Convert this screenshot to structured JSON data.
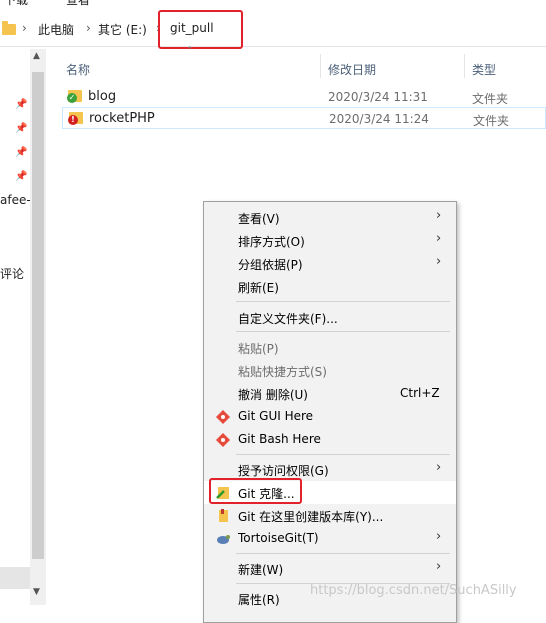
{
  "top_strip": {
    "text_a": "下载",
    "text_b": "查看"
  },
  "breadcrumb": {
    "items": [
      "此电脑",
      "其它 (E:)",
      "git_pull"
    ],
    "separator": "›"
  },
  "nav": {
    "fragment_1": "afee-a",
    "fragment_2": "评论"
  },
  "columns": {
    "name": "名称",
    "date": "修改日期",
    "type": "类型"
  },
  "files": [
    {
      "name": "blog",
      "date": "2020/3/24 11:31",
      "type": "文件夹",
      "overlay": "check-overlay",
      "overlay_color": "#3aa23a"
    },
    {
      "name": "rocketPHP",
      "date": "2020/3/24 11:24",
      "type": "文件夹",
      "overlay": "error-overlay",
      "overlay_color": "#d42020"
    }
  ],
  "context_menu": {
    "view": "查看(V)",
    "sort": "排序方式(O)",
    "group": "分组依据(P)",
    "refresh": "刷新(E)",
    "customize": "自定义文件夹(F)...",
    "paste": "粘贴(P)",
    "paste_shortcut": "粘贴快捷方式(S)",
    "undo": "撤消 删除(U)",
    "undo_shortcut": "Ctrl+Z",
    "git_gui": "Git GUI Here",
    "git_bash": "Git Bash Here",
    "grant_access": "授予访问权限(G)",
    "git_clone": "Git 克隆...",
    "git_create_repo": "Git 在这里创建版本库(Y)...",
    "tortoisegit": "TortoiseGit(T)",
    "new": "新建(W)",
    "properties": "属性(R)"
  },
  "watermark": "https://blog.csdn.net/SuchASilly",
  "colors": {
    "highlight_box": "#e1222a",
    "accent_folder": "#f4c44e"
  }
}
